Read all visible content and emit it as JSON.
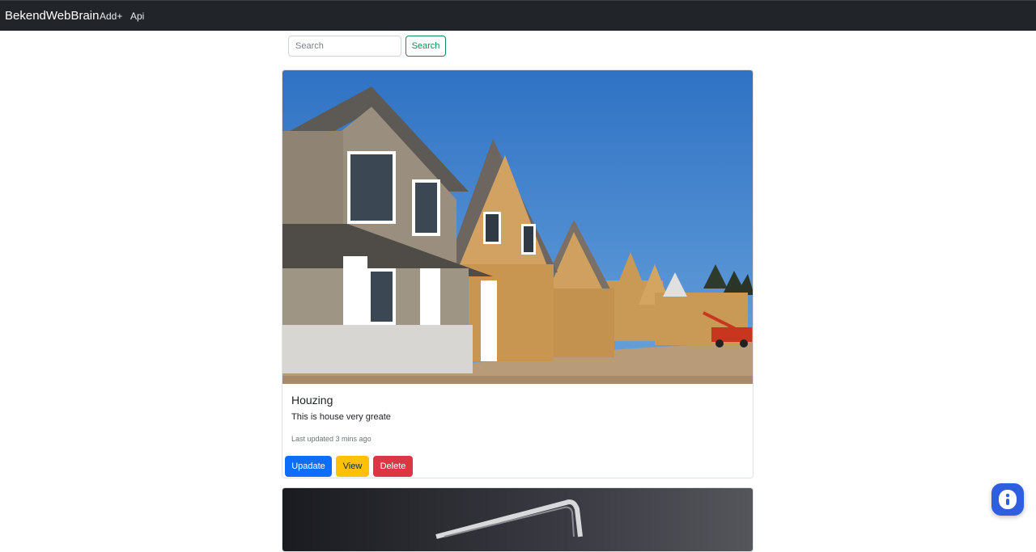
{
  "navbar": {
    "brand": "BekendWebBrain",
    "links": [
      {
        "label": "Add+"
      },
      {
        "label": "Api"
      }
    ]
  },
  "search": {
    "placeholder": "Search",
    "value": "",
    "button_label": "Search"
  },
  "posts": [
    {
      "title": "Houzing",
      "description": "This is house very greate",
      "updated": "Last updated 3 mins ago",
      "image_icon": "house-photo",
      "buttons": {
        "update": "Upadate",
        "view": "View",
        "delete": "Delete"
      }
    }
  ],
  "colors": {
    "navbar_bg": "#212529",
    "primary": "#0d6efd",
    "warning": "#ffc107",
    "danger": "#dc3545",
    "success": "#198754",
    "chat_button": "#2f5fe0"
  },
  "chat_widget": {
    "icon": "chat-icon"
  }
}
